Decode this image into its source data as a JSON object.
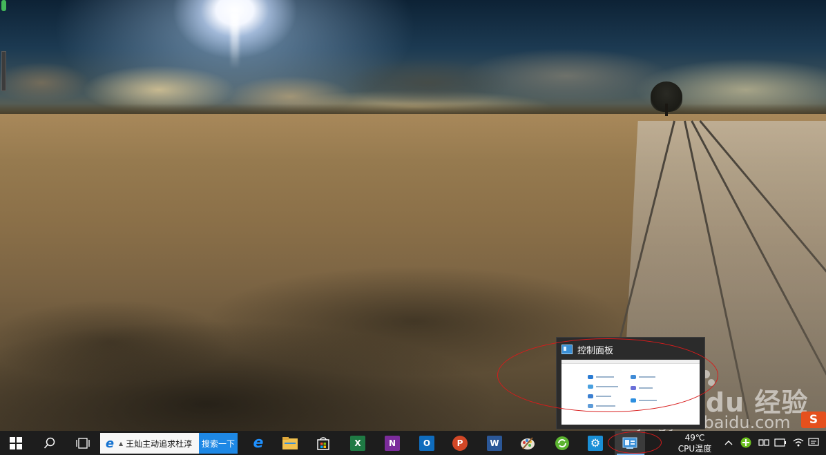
{
  "preview": {
    "title": "控制面板",
    "icon": "control-panel-icon"
  },
  "taskbar": {
    "start_icon": "windows-logo-icon",
    "search_icon": "search-icon",
    "task_view_icon": "task-view-icon",
    "search_box_text": "王灿主动追求杜淳",
    "search_button_label": "搜索一下",
    "apps": [
      {
        "name": "edge-icon",
        "letter": "e",
        "color": "#1573d1"
      },
      {
        "name": "file-explorer-icon",
        "letter": "",
        "color": "#f2c14e"
      },
      {
        "name": "store-icon",
        "letter": "",
        "color": "#ffffff"
      },
      {
        "name": "excel-icon",
        "letter": "X",
        "color": "#1f7a44"
      },
      {
        "name": "onenote-icon",
        "letter": "N",
        "color": "#7b2c9b"
      },
      {
        "name": "outlook-icon",
        "letter": "O",
        "color": "#0f6cbd"
      },
      {
        "name": "powerpoint-icon",
        "letter": "P",
        "color": "#d24726"
      },
      {
        "name": "word-icon",
        "letter": "W",
        "color": "#2b5797"
      },
      {
        "name": "paint-icon",
        "letter": "",
        "color": "#6b8fc7"
      },
      {
        "name": "refresh-green-icon",
        "letter": "",
        "color": "#5cb531"
      },
      {
        "name": "settings-icon",
        "letter": "⚙",
        "color": "#1a8fd6"
      },
      {
        "name": "control-panel-icon",
        "letter": "",
        "color": "#3a8fd6"
      }
    ],
    "cpu_temp": "49℃",
    "cpu_label": "CPU温度",
    "tray": {
      "chevron_icon": "chevron-up-icon",
      "plus_icon": "green-plus-icon",
      "network_icon": "network-icon",
      "battery_icon": "battery-icon",
      "volume_icon": "volume-icon",
      "wifi_icon": "wifi-icon",
      "notification_icon": "notification-icon"
    }
  },
  "watermark": {
    "brand": "Bai du 经验",
    "url": "jingyan.baidu.com",
    "logo_letter": "S"
  },
  "colors": {
    "taskbar_bg": "#1d1d1d",
    "search_button": "#1e88e5",
    "annotation_red": "#d81b1b"
  }
}
